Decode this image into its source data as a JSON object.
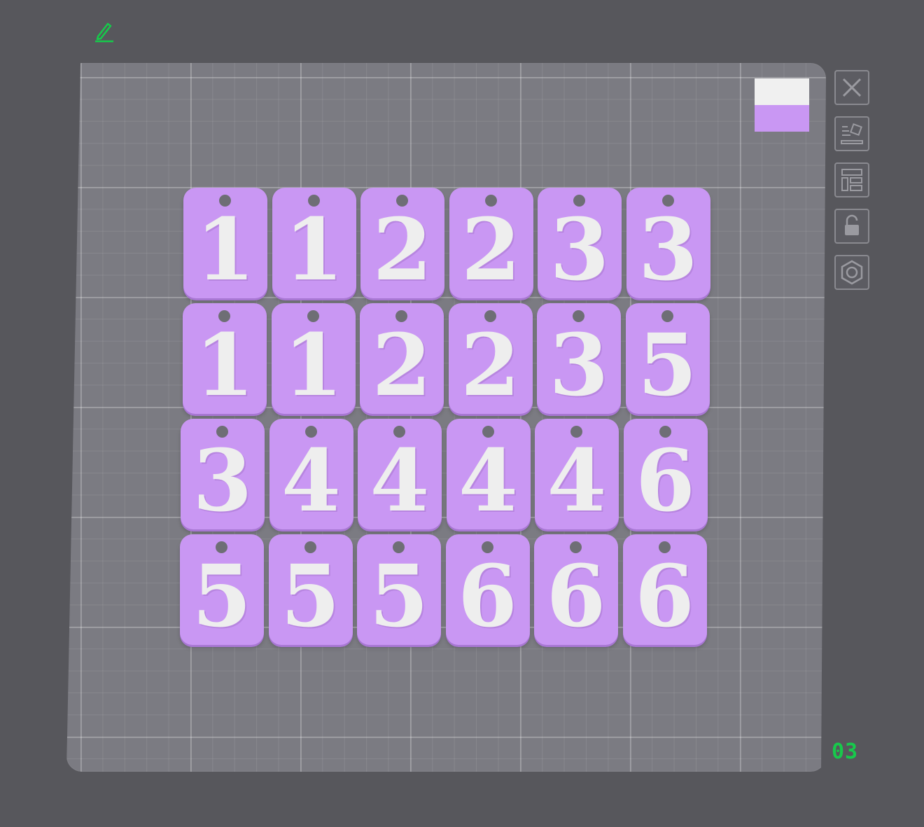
{
  "toolbar": {
    "edit_icon": "pencil-icon",
    "buttons": [
      {
        "name": "close",
        "icon": "close-icon"
      },
      {
        "name": "arrange",
        "icon": "arrange-icon"
      },
      {
        "name": "layout",
        "icon": "layout-icon"
      },
      {
        "name": "lock",
        "icon": "unlock-icon"
      },
      {
        "name": "settings",
        "icon": "nut-icon"
      }
    ]
  },
  "palette": {
    "colors": [
      "#f0f0f0",
      "#c997f3"
    ]
  },
  "tiles": {
    "rows": [
      [
        "1",
        "1",
        "2",
        "2",
        "3",
        "3"
      ],
      [
        "1",
        "1",
        "2",
        "2",
        "3",
        "5"
      ],
      [
        "3",
        "4",
        "4",
        "4",
        "4",
        "6"
      ],
      [
        "5",
        "5",
        "5",
        "6",
        "6",
        "6"
      ]
    ]
  },
  "status": {
    "layer_counter": "03"
  },
  "colors": {
    "tile": "#c997f3",
    "digit": "#eeeeee",
    "plate": "#7b7b82",
    "background": "#57575c",
    "accent": "#17c94b"
  }
}
